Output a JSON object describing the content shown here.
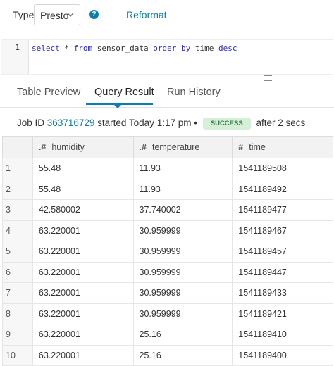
{
  "toolbar": {
    "type_label": "Type:",
    "engine_selected": "Presto",
    "help_icon": "?",
    "reformat_label": "Reformat"
  },
  "editor": {
    "line_number": "1",
    "query_tokens": [
      {
        "t": "select",
        "k": "kw"
      },
      {
        "t": " * ",
        "k": "id"
      },
      {
        "t": "from",
        "k": "kw"
      },
      {
        "t": " sensor_data ",
        "k": "id"
      },
      {
        "t": "order",
        "k": "kw"
      },
      {
        "t": " ",
        "k": "id"
      },
      {
        "t": "by",
        "k": "kw"
      },
      {
        "t": " time ",
        "k": "id"
      },
      {
        "t": "desc",
        "k": "kw"
      }
    ]
  },
  "tabs": [
    {
      "label": "Table Preview",
      "active": false
    },
    {
      "label": "Query Result",
      "active": true
    },
    {
      "label": "Run History",
      "active": false
    }
  ],
  "job": {
    "prefix": "Job ID",
    "id": "363716729",
    "started": "started Today 1:17 pm",
    "separator": "•",
    "status": "SUCCESS",
    "duration": "after 2 secs"
  },
  "results": {
    "columns": [
      {
        "type": ".#",
        "name": "humidity"
      },
      {
        "type": ".#",
        "name": "temperature"
      },
      {
        "type": "#",
        "name": "time"
      }
    ],
    "rows": [
      [
        "1",
        "55.48",
        "11.93",
        "1541189508"
      ],
      [
        "2",
        "55.48",
        "11.93",
        "1541189492"
      ],
      [
        "3",
        "42.580002",
        "37.740002",
        "1541189477"
      ],
      [
        "4",
        "63.220001",
        "30.959999",
        "1541189467"
      ],
      [
        "5",
        "63.220001",
        "30.959999",
        "1541189457"
      ],
      [
        "6",
        "63.220001",
        "30.959999",
        "1541189447"
      ],
      [
        "7",
        "63.220001",
        "30.959999",
        "1541189433"
      ],
      [
        "8",
        "63.220001",
        "30.959999",
        "1541189421"
      ],
      [
        "9",
        "63.220001",
        "25.16",
        "1541189410"
      ],
      [
        "10",
        "63.220001",
        "25.16",
        "1541189400"
      ]
    ]
  },
  "colors": {
    "accent": "#0b7fab",
    "success_bg": "#d5efd8",
    "success_fg": "#3a7d44"
  }
}
